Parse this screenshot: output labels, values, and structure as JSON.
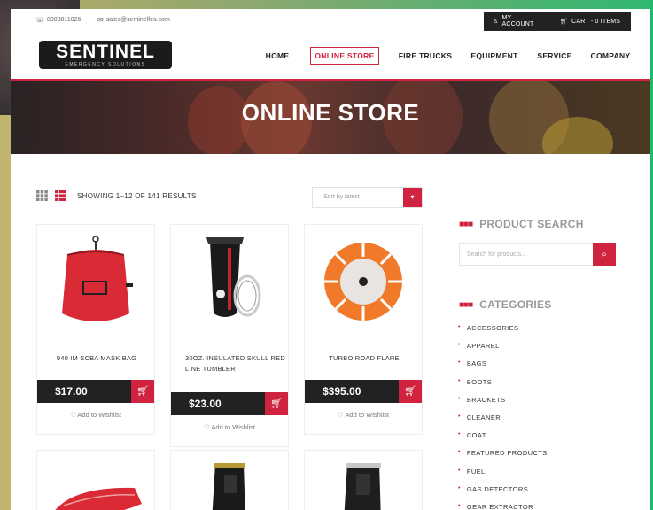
{
  "topbar": {
    "phone": "8008811026",
    "email": "sales@sentinelfes.com",
    "account_label": "MY ACCOUNT",
    "cart_label": "CART - 0 ITEMS"
  },
  "logo": {
    "name": "SENTINEL",
    "tagline": "EMERGENCY SOLUTIONS"
  },
  "nav": [
    "HOME",
    "ONLINE STORE",
    "FIRE TRUCKS",
    "EQUIPMENT",
    "SERVICE",
    "COMPANY"
  ],
  "hero": {
    "title": "ONLINE STORE"
  },
  "toolbar": {
    "results": "SHOWING 1–12 OF 141 RESULTS",
    "sort_value": "Sort by latest"
  },
  "products": [
    {
      "name": "940 IM SCBA MASK BAG",
      "price": "$17.00",
      "wishlist": "Add to Wishlist"
    },
    {
      "name": "30OZ. INSULATED SKULL RED LINE TUMBLER",
      "price": "$23.00",
      "wishlist": "Add to Wishlist"
    },
    {
      "name": "TURBO ROAD FLARE",
      "price": "$395.00",
      "wishlist": "Add to Wishlist"
    }
  ],
  "sidebar": {
    "search_title": "PRODUCT SEARCH",
    "search_placeholder": "Search for products...",
    "categories_title": "CATEGORIES",
    "categories": [
      "ACCESSORIES",
      "APPAREL",
      "BAGS",
      "BOOTS",
      "BRACKETS",
      "CLEANER",
      "COAT",
      "FEATURED PRODUCTS",
      "FUEL",
      "GAS DETECTORS",
      "GEAR EXTRACTOR"
    ]
  },
  "colors": {
    "accent": "#d0233f",
    "dark": "#222222"
  }
}
